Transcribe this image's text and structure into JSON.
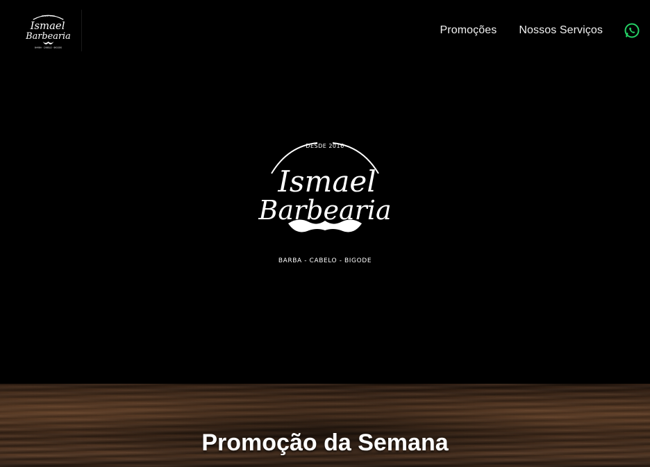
{
  "nav": {
    "logo": {
      "script_line1": "Ismael",
      "script_line2": "Barbearia",
      "tagline": "BARBA · CABELO · BIGODE",
      "since": "DESDE 2016"
    },
    "links": [
      "Promoções",
      "Nossos Serviços"
    ],
    "whatsapp_icon": "whatsapp-icon",
    "whatsapp_color": "#25d366"
  },
  "hero": {
    "logo": {
      "since": "DESDE 2016",
      "script_line1": "Ismael",
      "script_line2": "Barbearia",
      "tagline": "BARBA - CABELO - BIGODE"
    }
  },
  "promo": {
    "title": "Promoção da Semana"
  }
}
